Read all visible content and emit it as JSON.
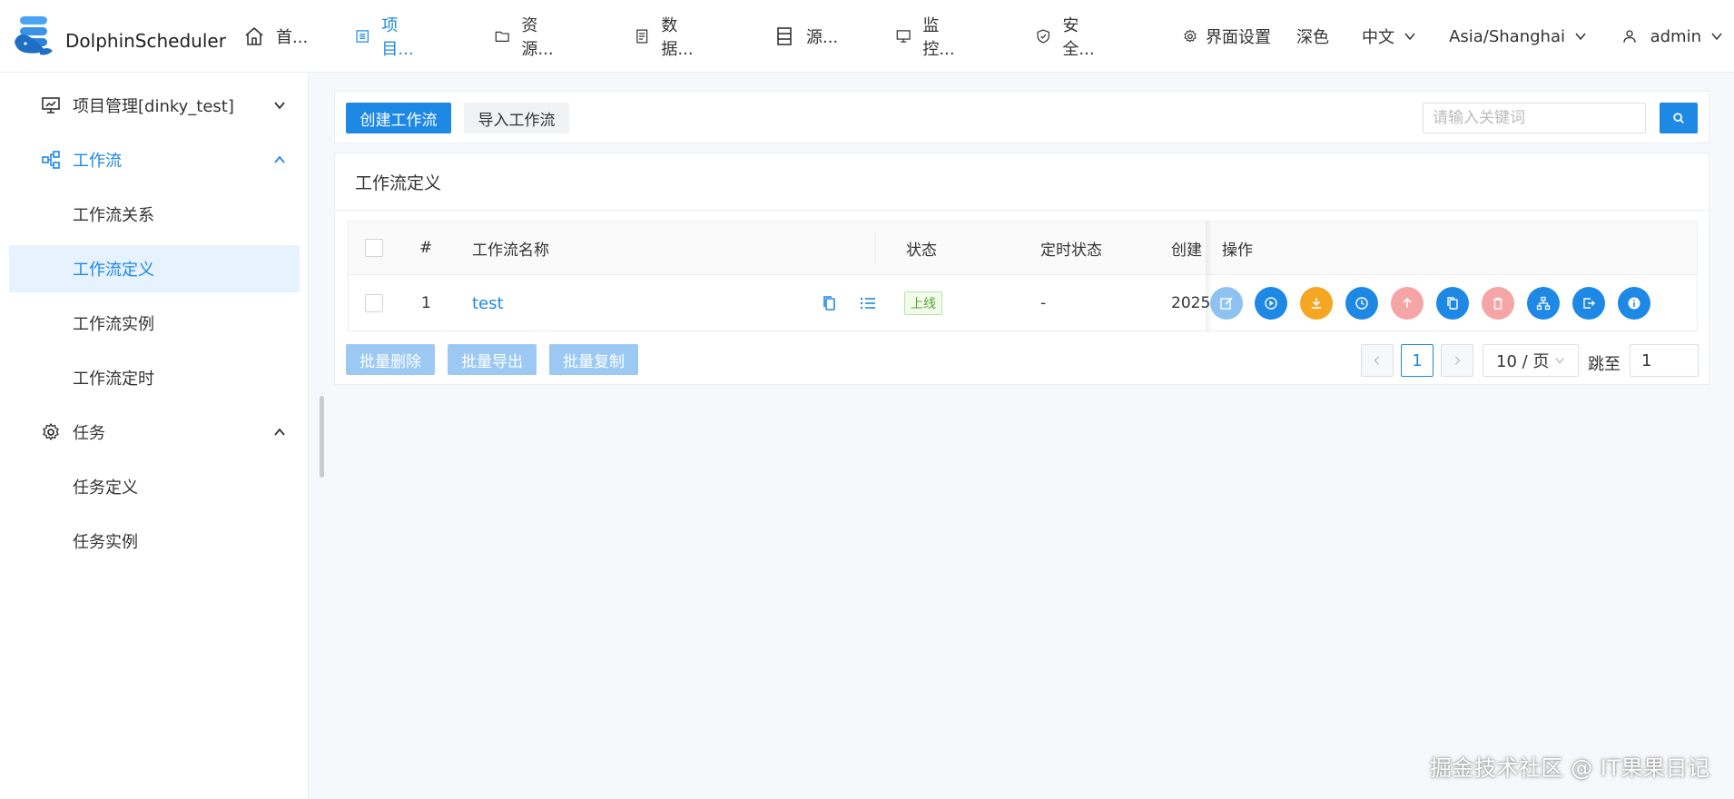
{
  "app": {
    "name": "DolphinScheduler"
  },
  "nav": [
    {
      "label": "首...",
      "icon": "home-icon"
    },
    {
      "label": "项目...",
      "icon": "project-icon",
      "active": true
    },
    {
      "label": "资源...",
      "icon": "folder-icon"
    },
    {
      "label": "数据...",
      "icon": "document-icon"
    },
    {
      "label": "源...",
      "icon": "server-icon"
    },
    {
      "label": "监控...",
      "icon": "monitor-icon"
    },
    {
      "label": "安全...",
      "icon": "shield-icon"
    }
  ],
  "header_right": {
    "ui_settings": "界面设置",
    "theme": "深色",
    "language": "中文",
    "timezone": "Asia/Shanghai",
    "user": "admin"
  },
  "sidebar": {
    "project": "项目管理[dinky_test]",
    "workflow_group": "工作流",
    "workflow_items": [
      "工作流关系",
      "工作流定义",
      "工作流实例",
      "工作流定时"
    ],
    "task_group": "任务",
    "task_items": [
      "任务定义",
      "任务实例"
    ]
  },
  "toolbar": {
    "create_label": "创建工作流",
    "import_label": "导入工作流",
    "search_placeholder": "请输入关键词"
  },
  "table": {
    "title": "工作流定义",
    "columns": {
      "index": "#",
      "name": "工作流名称",
      "status": "状态",
      "schedule_status": "定时状态",
      "created": "创建",
      "operations": "操作"
    },
    "rows": [
      {
        "index": "1",
        "name": "test",
        "status": "上线",
        "schedule_status": "-",
        "created": "2025"
      }
    ]
  },
  "batch": {
    "delete": "批量删除",
    "export": "批量导出",
    "copy": "批量复制"
  },
  "pagination": {
    "current": "1",
    "page_size": "10 / 页",
    "jump_label": "跳至",
    "jump_value": "1"
  },
  "colors": {
    "primary": "#1e88e5",
    "warning": "#f5a623",
    "danger_light": "#f5a5a5",
    "primary_light": "#8ec3f1"
  },
  "watermark": "掘金技术社区 @ IT果果日记"
}
